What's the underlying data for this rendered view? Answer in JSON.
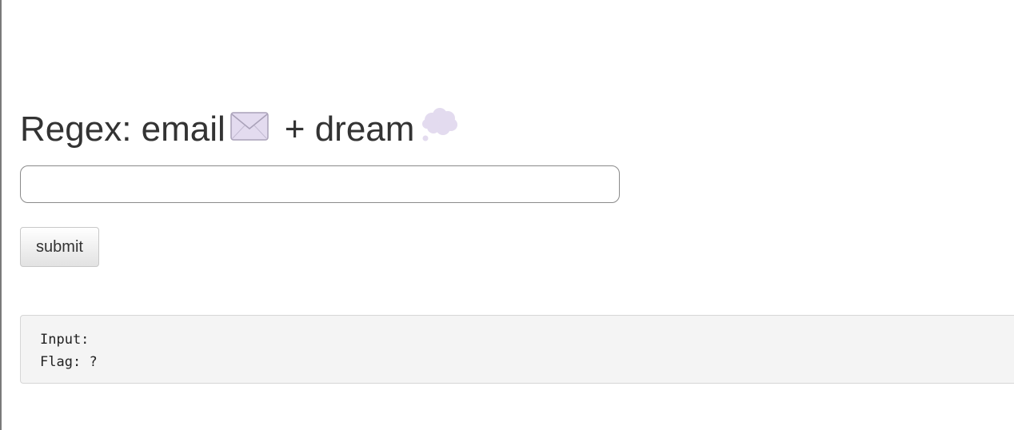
{
  "header": {
    "title_prefix": "Regex: email",
    "title_middle": "+ dream",
    "envelope_icon": "envelope-icon",
    "cloud_icon": "thought-balloon-icon"
  },
  "form": {
    "input_value": "",
    "input_placeholder": "",
    "submit_label": "submit"
  },
  "output": {
    "input_label": "Input:",
    "input_value": "",
    "flag_label": "Flag:",
    "flag_value": "?"
  },
  "colors": {
    "text": "#333333",
    "icon_fill": "#e3dbef",
    "icon_stroke": "#a9a1b8",
    "output_bg": "#f4f4f4"
  }
}
